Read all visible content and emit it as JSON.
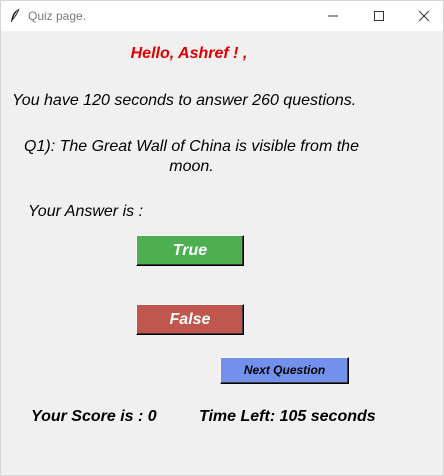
{
  "window": {
    "title": "Quiz page.",
    "icon": "feather-icon",
    "controls": [
      "minimize-icon",
      "maximize-icon",
      "close-icon"
    ]
  },
  "quiz": {
    "greeting": "Hello, Ashref ! ,",
    "instructions": "You have 120 seconds to answer 260 questions.",
    "question_line1": "Q1): The Great Wall of China is visible from the",
    "question_line2": "moon.",
    "answer_label": "Your Answer is :",
    "true_label": "True",
    "false_label": "False",
    "next_label": "Next Question",
    "score_text": "Your Score is : 0",
    "timer_text": "Time Left: 105 seconds"
  },
  "colors": {
    "greeting": "#e00000",
    "true_button": "#4caf50",
    "false_button": "#c0574f",
    "next_button": "#7391ec",
    "background": "#f0f0f0"
  }
}
